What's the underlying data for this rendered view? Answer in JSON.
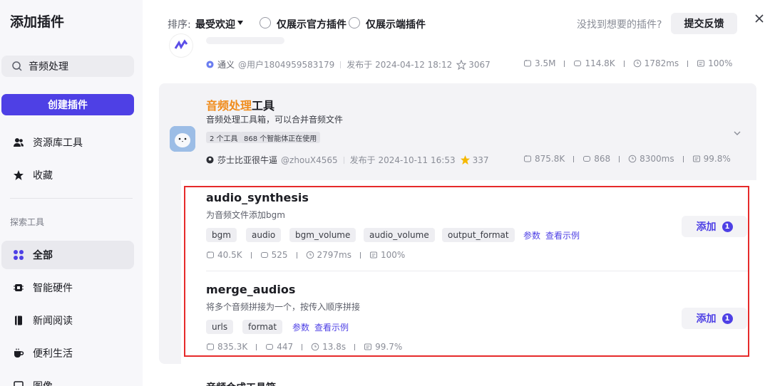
{
  "sidebar": {
    "title": "添加插件",
    "search_value": "音频处理",
    "create_label": "创建插件",
    "top_items": [
      {
        "label": "资源库工具",
        "icon": "people-icon"
      },
      {
        "label": "收藏",
        "icon": "star-icon"
      }
    ],
    "section_label": "探索工具",
    "categories": [
      {
        "label": "全部",
        "icon": "grid-icon",
        "active": true
      },
      {
        "label": "智能硬件",
        "icon": "chip-icon"
      },
      {
        "label": "新闻阅读",
        "icon": "book-icon"
      },
      {
        "label": "便利生活",
        "icon": "cup-icon"
      },
      {
        "label": "图像",
        "icon": "image-icon"
      }
    ]
  },
  "header": {
    "sort_label": "排序:",
    "sort_value": "最受欢迎",
    "filter_official": "仅展示官方插件",
    "filter_client": "仅展示端插件",
    "hint": "没找到想要的插件?",
    "feedback_label": "提交反馈"
  },
  "top_card": {
    "author_badge": "通义",
    "author": "@用户1804959583179",
    "published": "发布于 2024-04-12 18:12",
    "stars": "3067",
    "stats": {
      "calls": "3.5M",
      "bots": "114.8K",
      "latency": "1782ms",
      "success": "100%"
    }
  },
  "plugin": {
    "title_highlight": "音频处理",
    "title_rest": "工具",
    "description": "音频处理工具箱，可以合并音频文件",
    "badge_tools": "2 个工具",
    "badge_bots": "868 个智能体正在使用",
    "author_name": "莎士比亚很牛逼",
    "author_handle": "@zhouX4565",
    "published": "发布于 2024-10-11 16:53",
    "stars": "337",
    "stats": {
      "calls": "875.8K",
      "bots": "868",
      "latency": "8300ms",
      "success": "99.8%"
    },
    "tools": [
      {
        "name": "audio_synthesis",
        "description": "为音频文件添加bgm",
        "tags": [
          "bgm",
          "audio",
          "bgm_volume",
          "audio_volume",
          "output_format"
        ],
        "link_params": "参数",
        "link_example": "查看示例",
        "stats": {
          "calls": "40.5K",
          "bots": "525",
          "latency": "2797ms",
          "success": "100%"
        },
        "add_label": "添加",
        "add_count": "1"
      },
      {
        "name": "merge_audios",
        "description": "将多个音频拼接为一个，按传入顺序拼接",
        "tags": [
          "urls",
          "format"
        ],
        "link_params": "参数",
        "link_example": "查看示例",
        "stats": {
          "calls": "835.3K",
          "bots": "447",
          "latency": "13.8s",
          "success": "99.7%"
        },
        "add_label": "添加",
        "add_count": "1"
      }
    ]
  },
  "next_card_title": "音频合成工具箱",
  "colors": {
    "accent": "#4e40e5",
    "highlight": "#f08c1c",
    "annotation": "#e62a2a",
    "star": "#f5b800"
  }
}
